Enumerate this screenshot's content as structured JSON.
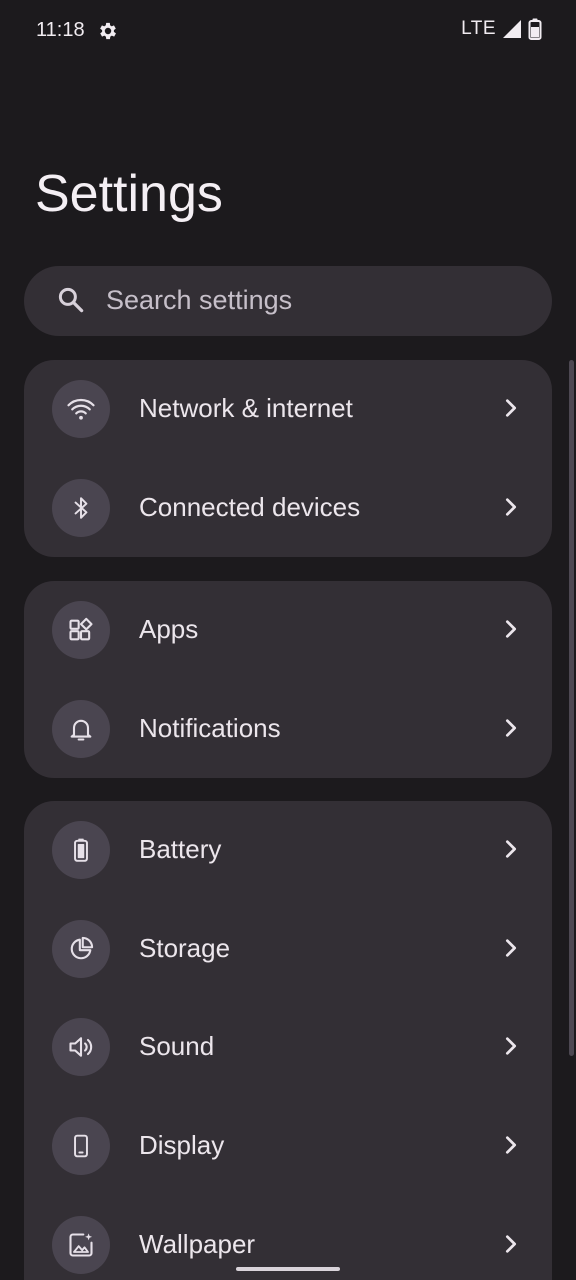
{
  "status_bar": {
    "time": "11:18",
    "network": "LTE",
    "icons": [
      "gear-icon",
      "signal-icon",
      "battery-icon"
    ]
  },
  "title": "Settings",
  "search": {
    "placeholder": "Search settings",
    "icon": "search-icon"
  },
  "groups": [
    {
      "items": [
        {
          "label": "Network & internet",
          "icon": "wifi-icon"
        },
        {
          "label": "Connected devices",
          "icon": "bluetooth-icon"
        }
      ]
    },
    {
      "items": [
        {
          "label": "Apps",
          "icon": "apps-icon"
        },
        {
          "label": "Notifications",
          "icon": "bell-icon"
        }
      ]
    },
    {
      "items": [
        {
          "label": "Battery",
          "icon": "battery-icon"
        },
        {
          "label": "Storage",
          "icon": "storage-pie-icon"
        },
        {
          "label": "Sound",
          "icon": "speaker-icon"
        },
        {
          "label": "Display",
          "icon": "phone-display-icon"
        },
        {
          "label": "Wallpaper",
          "icon": "wallpaper-icon"
        }
      ]
    }
  ],
  "colors": {
    "background": "#1c1a1d",
    "card": "#332f35",
    "icon_circle": "#4a4550",
    "text": "#ece6ec"
  }
}
